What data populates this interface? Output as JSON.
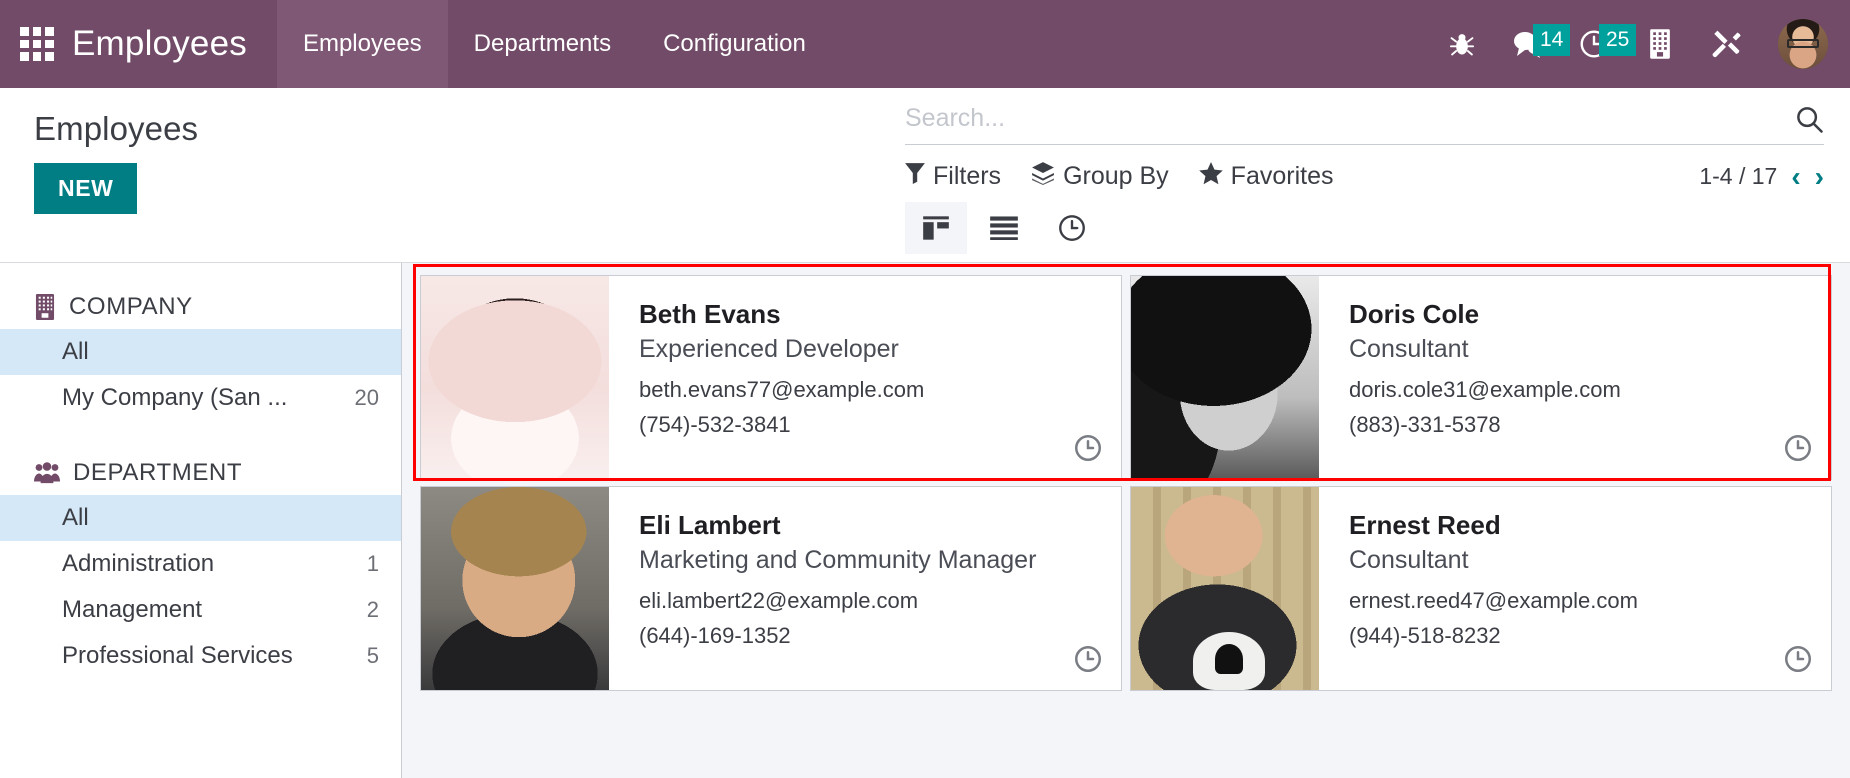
{
  "navbar": {
    "apps_icon": "apps-grid-icon",
    "brand": "Employees",
    "tabs": [
      {
        "label": "Employees",
        "active": true
      },
      {
        "label": "Departments",
        "active": false
      },
      {
        "label": "Configuration",
        "active": false
      }
    ],
    "icons": [
      {
        "name": "bug-icon",
        "badge": null
      },
      {
        "name": "messages-icon",
        "badge": "14"
      },
      {
        "name": "activities-clock-icon",
        "badge": "25"
      },
      {
        "name": "company-building-icon",
        "badge": null
      },
      {
        "name": "debug-tools-icon",
        "badge": null
      }
    ],
    "avatar": "user-avatar"
  },
  "control_panel": {
    "page_title": "Employees",
    "new_button": "NEW",
    "search": {
      "placeholder": "Search...",
      "value": ""
    },
    "search_icon": "search-icon",
    "filters": [
      {
        "label": "Filters",
        "icon": "filter-funnel-icon"
      },
      {
        "label": "Group By",
        "icon": "layers-icon"
      },
      {
        "label": "Favorites",
        "icon": "star-icon"
      }
    ],
    "pager": {
      "range": "1-4 / 17",
      "prev": "‹",
      "next": "›"
    },
    "views": [
      {
        "name": "kanban-view",
        "active": true
      },
      {
        "name": "list-view",
        "active": false
      },
      {
        "name": "activity-view",
        "active": false
      }
    ]
  },
  "sidebar": {
    "sections": [
      {
        "title": "COMPANY",
        "icon": "building-icon",
        "items": [
          {
            "label": "All",
            "count": "",
            "selected": true
          },
          {
            "label": "My Company (San ...",
            "count": "20",
            "selected": false
          }
        ]
      },
      {
        "title": "DEPARTMENT",
        "icon": "users-group-icon",
        "items": [
          {
            "label": "All",
            "count": "",
            "selected": true
          },
          {
            "label": "Administration",
            "count": "1",
            "selected": false
          },
          {
            "label": "Management",
            "count": "2",
            "selected": false
          },
          {
            "label": "Professional Services",
            "count": "5",
            "selected": false
          }
        ]
      }
    ]
  },
  "employees": [
    {
      "name": "Beth Evans",
      "job_title": "Experienced Developer",
      "email": "beth.evans77@example.com",
      "phone": "(754)-532-3841",
      "photo_class": "ph-beth"
    },
    {
      "name": "Doris Cole",
      "job_title": "Consultant",
      "email": "doris.cole31@example.com",
      "phone": "(883)-331-5378",
      "photo_class": "ph-doris"
    },
    {
      "name": "Eli Lambert",
      "job_title": "Marketing and Community Manager",
      "email": "eli.lambert22@example.com",
      "phone": "(644)-169-1352",
      "photo_class": "ph-eli"
    },
    {
      "name": "Ernest Reed",
      "job_title": "Consultant",
      "email": "ernest.reed47@example.com",
      "phone": "(944)-518-8232",
      "photo_class": "ph-ernest"
    }
  ],
  "colors": {
    "navbar_purple": "#714B67",
    "navbar_active": "#7F5875",
    "teal": "#017E84",
    "badge_teal": "#00A09D",
    "highlight_red": "#ff0000",
    "selected_blue": "#d5e8f7"
  }
}
